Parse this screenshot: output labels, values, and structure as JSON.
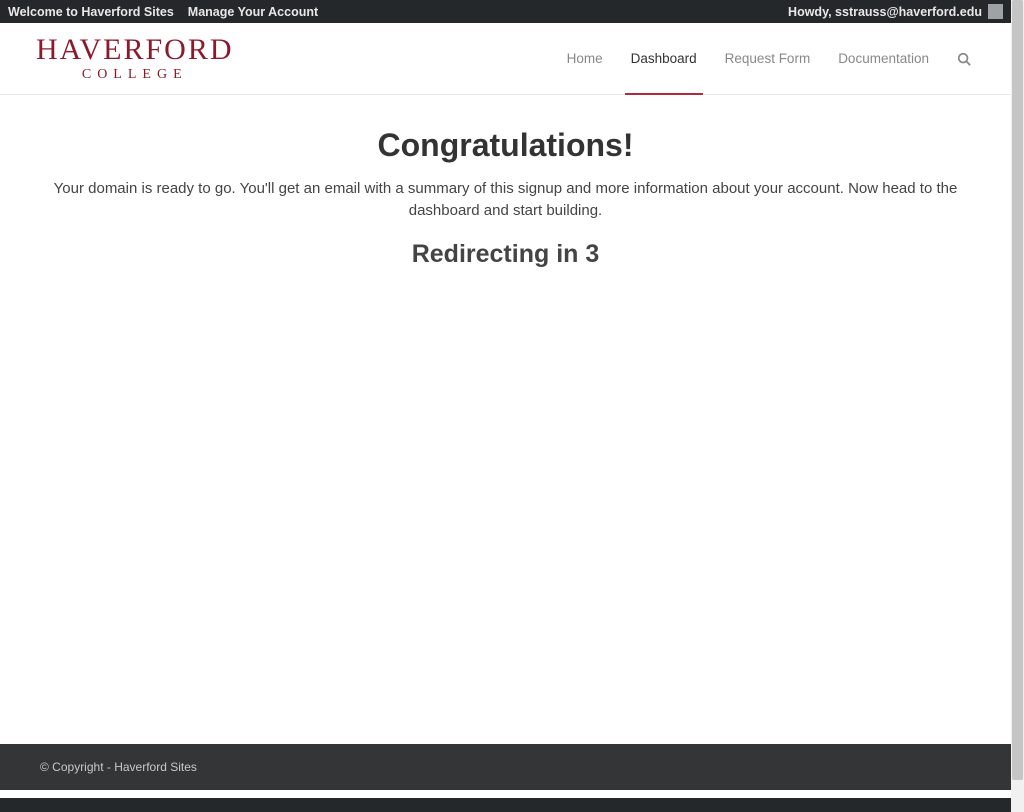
{
  "adminBar": {
    "welcome": "Welcome to Haverford Sites",
    "manage": "Manage Your Account",
    "greeting": "Howdy, sstrauss@haverford.edu"
  },
  "logo": {
    "main": "HAVERFORD",
    "sub": "COLLEGE"
  },
  "nav": {
    "home": "Home",
    "dashboard": "Dashboard",
    "request": "Request Form",
    "documentation": "Documentation"
  },
  "main": {
    "title": "Congratulations!",
    "subtitle": "Your domain is ready to go. You'll get an email with a summary of this signup and more information about your account. Now head to the dashboard and start building.",
    "redirect": "Redirecting in 3"
  },
  "footer": {
    "copyright": "© Copyright - Haverford Sites"
  }
}
